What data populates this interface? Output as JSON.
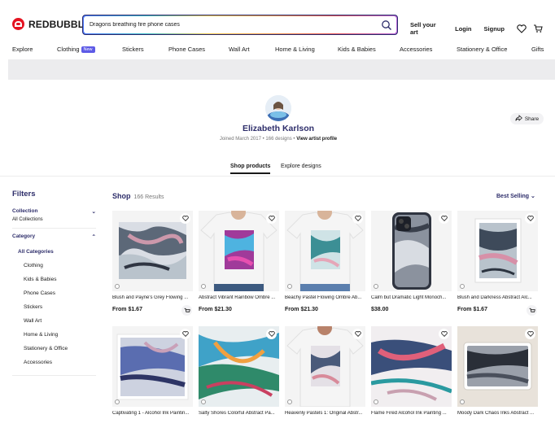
{
  "header": {
    "logo_text": "REDBUBBLE",
    "search_value": "Dragons breathing fire phone cases",
    "sell": "Sell your art",
    "login": "Login",
    "signup": "Signup"
  },
  "nav": {
    "items": [
      "Explore",
      "Clothing",
      "Stickers",
      "Phone Cases",
      "Wall Art",
      "Home & Living",
      "Kids & Babies",
      "Accessories",
      "Stationery & Office",
      "Gifts"
    ],
    "new_badge": "New"
  },
  "profile": {
    "name": "Elizabeth Karlson",
    "joined": "Joined March 2017",
    "designs": "166 designs",
    "view_profile": "View artist profile",
    "share": "Share"
  },
  "tabs": [
    "Shop products",
    "Explore designs"
  ],
  "filters": {
    "title": "Filters",
    "collection_label": "Collection",
    "collection_value": "All Collections",
    "category_label": "Category",
    "categories": [
      "All Categories",
      "Clothing",
      "Kids & Babies",
      "Phone Cases",
      "Stickers",
      "Wall Art",
      "Home & Living",
      "Stationery & Office",
      "Accessories"
    ]
  },
  "shop": {
    "title": "Shop",
    "count": "166 Results",
    "sort": "Best Selling"
  },
  "products": [
    {
      "title": "Blush and Payne's Grey Flowing ...",
      "price": "From $1.67"
    },
    {
      "title": "Abstract Vibrant Rainbow Ombre ...",
      "price": "From $21.30"
    },
    {
      "title": "Beachy Pastel Flowing Ombre Ab...",
      "price": "From $21.30"
    },
    {
      "title": "Calm but Dramatic Light Monoch...",
      "price": "$38.00"
    },
    {
      "title": "Blush and Darkness Abstract Alc...",
      "price": "From $1.67"
    },
    {
      "title": "Captivating 1 - Alcohol Ink Paintin...",
      "price": ""
    },
    {
      "title": "Salty Shores Colorful Abstract Pa...",
      "price": ""
    },
    {
      "title": "Heavenly Pastels 1: Original Abstr...",
      "price": ""
    },
    {
      "title": "Flame Fired Alcohol Ink Painting ...",
      "price": ""
    },
    {
      "title": "Moody Dark Chaos Inks Abstract ...",
      "price": ""
    }
  ]
}
